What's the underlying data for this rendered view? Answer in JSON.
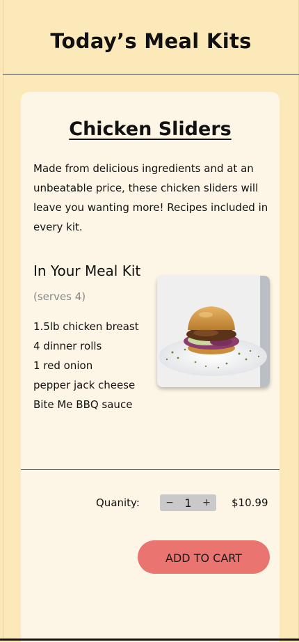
{
  "header": {
    "title": "Today’s Meal Kits"
  },
  "product": {
    "title": "Chicken Sliders",
    "description": "Made from delicious ingredients and at an unbeatable price, these chicken sliders will leave you wanting more! Recipes included in every kit.",
    "kit_heading": "In Your Meal Kit",
    "serves": "(serves 4)",
    "ingredients": [
      "1.5lb chicken breast",
      "4 dinner rolls",
      "1 red onion",
      "pepper jack cheese",
      "Bite Me BBQ sauce"
    ],
    "image_icon": "slider-burger-photo"
  },
  "purchase": {
    "quantity_label": "Quanity:",
    "decrement_symbol": "−",
    "quantity": "1",
    "increment_symbol": "+",
    "price": "$10.99",
    "add_to_cart_label": "ADD TO CART",
    "button_color": "#ea7470"
  },
  "colors": {
    "page_bg": "#fbe9b9",
    "card_bg": "#fdf6e6"
  }
}
